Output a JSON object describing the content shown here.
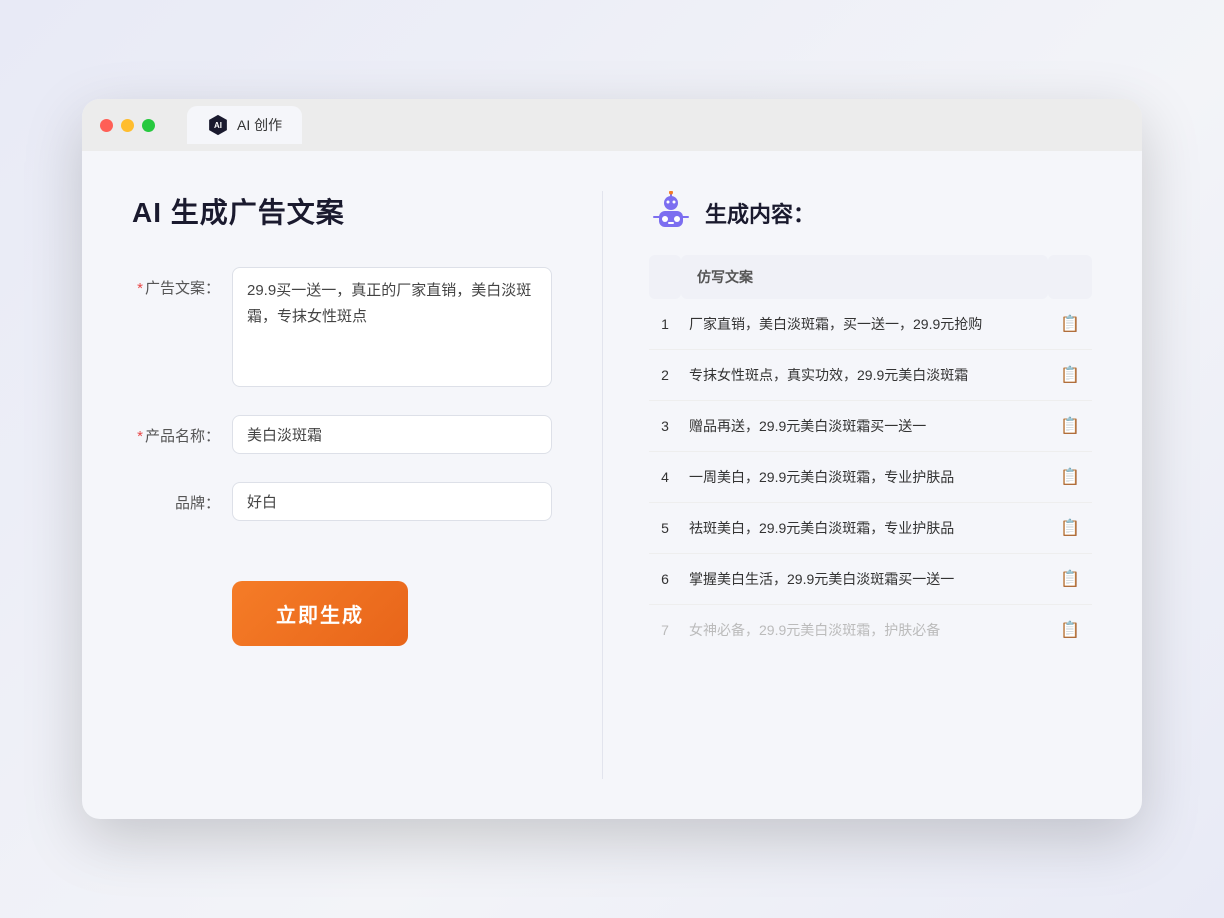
{
  "browser": {
    "tab_label": "AI 创作",
    "traffic_lights": [
      "red",
      "yellow",
      "green"
    ]
  },
  "page": {
    "title": "AI 生成广告文案",
    "form": {
      "ad_copy_label": "广告文案：",
      "ad_copy_required": "*",
      "ad_copy_value": "29.9买一送一，真正的厂家直销，美白淡斑霜，专抹女性斑点",
      "product_name_label": "产品名称：",
      "product_name_required": "*",
      "product_name_value": "美白淡斑霜",
      "brand_label": "品牌：",
      "brand_value": "好白",
      "generate_button": "立即生成"
    },
    "result": {
      "header": "生成内容：",
      "column_label": "仿写文案",
      "items": [
        {
          "num": 1,
          "text": "厂家直销，美白淡斑霜，买一送一，29.9元抢购"
        },
        {
          "num": 2,
          "text": "专抹女性斑点，真实功效，29.9元美白淡斑霜"
        },
        {
          "num": 3,
          "text": "赠品再送，29.9元美白淡斑霜买一送一"
        },
        {
          "num": 4,
          "text": "一周美白，29.9元美白淡斑霜，专业护肤品"
        },
        {
          "num": 5,
          "text": "祛斑美白，29.9元美白淡斑霜，专业护肤品"
        },
        {
          "num": 6,
          "text": "掌握美白生活，29.9元美白淡斑霜买一送一"
        },
        {
          "num": 7,
          "text": "女神必备，29.9元美白淡斑霜，护肤必备",
          "faded": true
        }
      ]
    }
  }
}
